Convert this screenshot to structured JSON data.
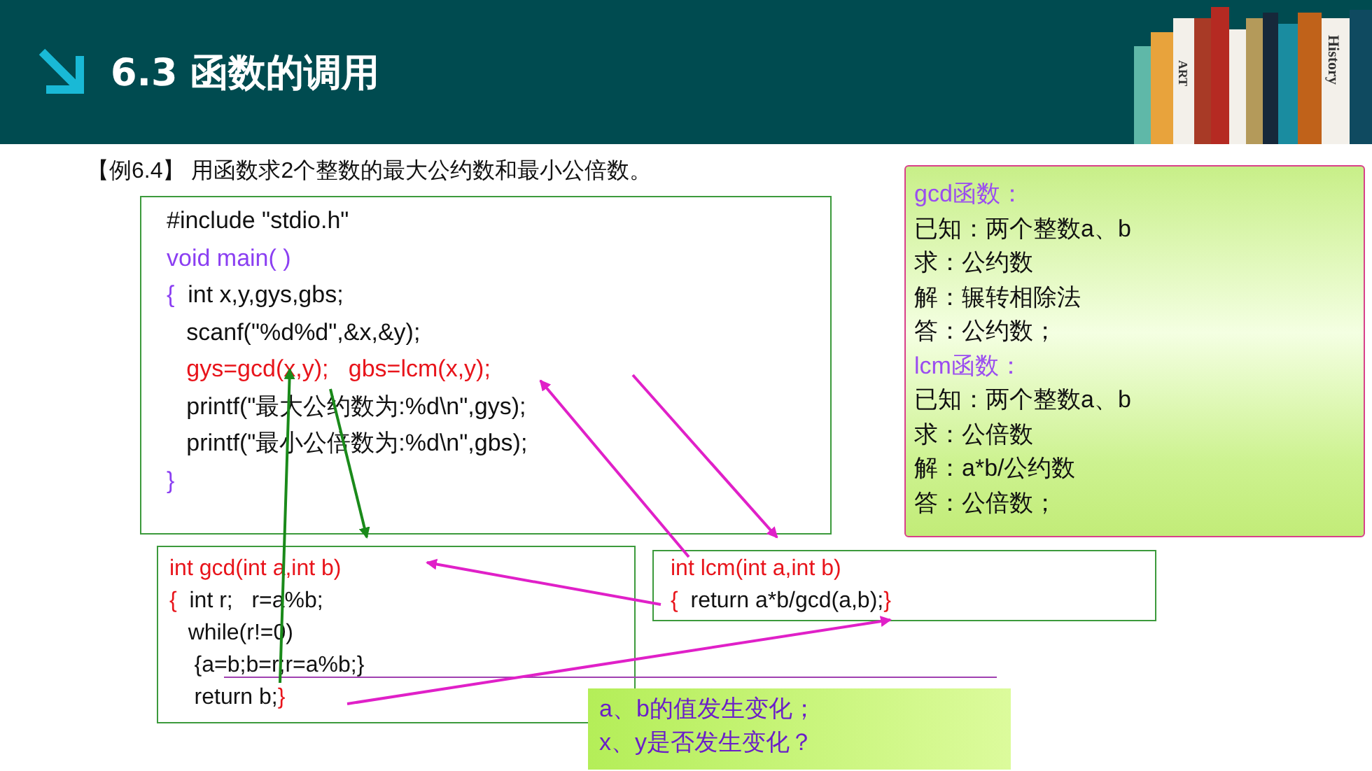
{
  "header": {
    "title": "6.3 函数的调用",
    "book_labels": [
      "ART",
      "History"
    ]
  },
  "example": {
    "label": "【例6.4】",
    "text": "用函数求2个整数的最大公约数和最小公倍数。"
  },
  "main_code": [
    [
      {
        "kind": "plain",
        "text": "#include \"stdio.h\""
      }
    ],
    [
      {
        "kind": "keyword",
        "text": "void main( )"
      }
    ],
    [
      {
        "kind": "keyword",
        "text": "{"
      },
      {
        "kind": "plain",
        "text": "  int x,y,gys,gbs;"
      }
    ],
    [
      {
        "kind": "plain",
        "text": "   scanf(\"%d%d\",&x,&y);"
      }
    ],
    [
      {
        "kind": "accent",
        "text": "   gys=gcd(x,y);   gbs=lcm(x,y);"
      }
    ],
    [
      {
        "kind": "plain",
        "text": "   printf(\"最大公约数为:%d\\n\",gys);"
      }
    ],
    [
      {
        "kind": "plain",
        "text": "   printf(\"最小公倍数为:%d\\n\",gbs);"
      }
    ],
    [
      {
        "kind": "keyword",
        "text": "}"
      }
    ]
  ],
  "gcd_code": [
    [
      {
        "kind": "accent",
        "text": "int gcd(int a,int b)"
      }
    ],
    [
      {
        "kind": "accent",
        "text": "{"
      },
      {
        "kind": "plain",
        "text": "  int r;   r=a%b;"
      }
    ],
    [
      {
        "kind": "plain",
        "text": "   while(r!=0)"
      }
    ],
    [
      {
        "kind": "plain",
        "text": "    {a=b;b=r;r=a%b;}"
      }
    ],
    [
      {
        "kind": "plain",
        "text": "    return b;"
      },
      {
        "kind": "accent",
        "text": "}"
      }
    ]
  ],
  "lcm_code": [
    [
      {
        "kind": "accent",
        "text": "int lcm(int a,int b)"
      }
    ],
    [
      {
        "kind": "accent",
        "text": "{"
      },
      {
        "kind": "plain",
        "text": "  return a*b/gcd(a,b);"
      },
      {
        "kind": "accent",
        "text": "}"
      }
    ]
  ],
  "note": [
    {
      "kind": "heading",
      "text": "gcd函数："
    },
    {
      "kind": "line",
      "text": "已知：两个整数a、b"
    },
    {
      "kind": "line",
      "text": "求：公约数"
    },
    {
      "kind": "line",
      "text": "解：辗转相除法"
    },
    {
      "kind": "line",
      "text": "答：公约数；"
    },
    {
      "kind": "heading",
      "text": "lcm函数："
    },
    {
      "kind": "line",
      "text": "已知：两个整数a、b"
    },
    {
      "kind": "line",
      "text": "求：公倍数"
    },
    {
      "kind": "line",
      "text": "解：a*b/公约数"
    },
    {
      "kind": "line",
      "text": "答：公倍数；"
    }
  ],
  "callout": [
    "a、b的值发生变化；",
    "x、y是否发生变化？"
  ]
}
